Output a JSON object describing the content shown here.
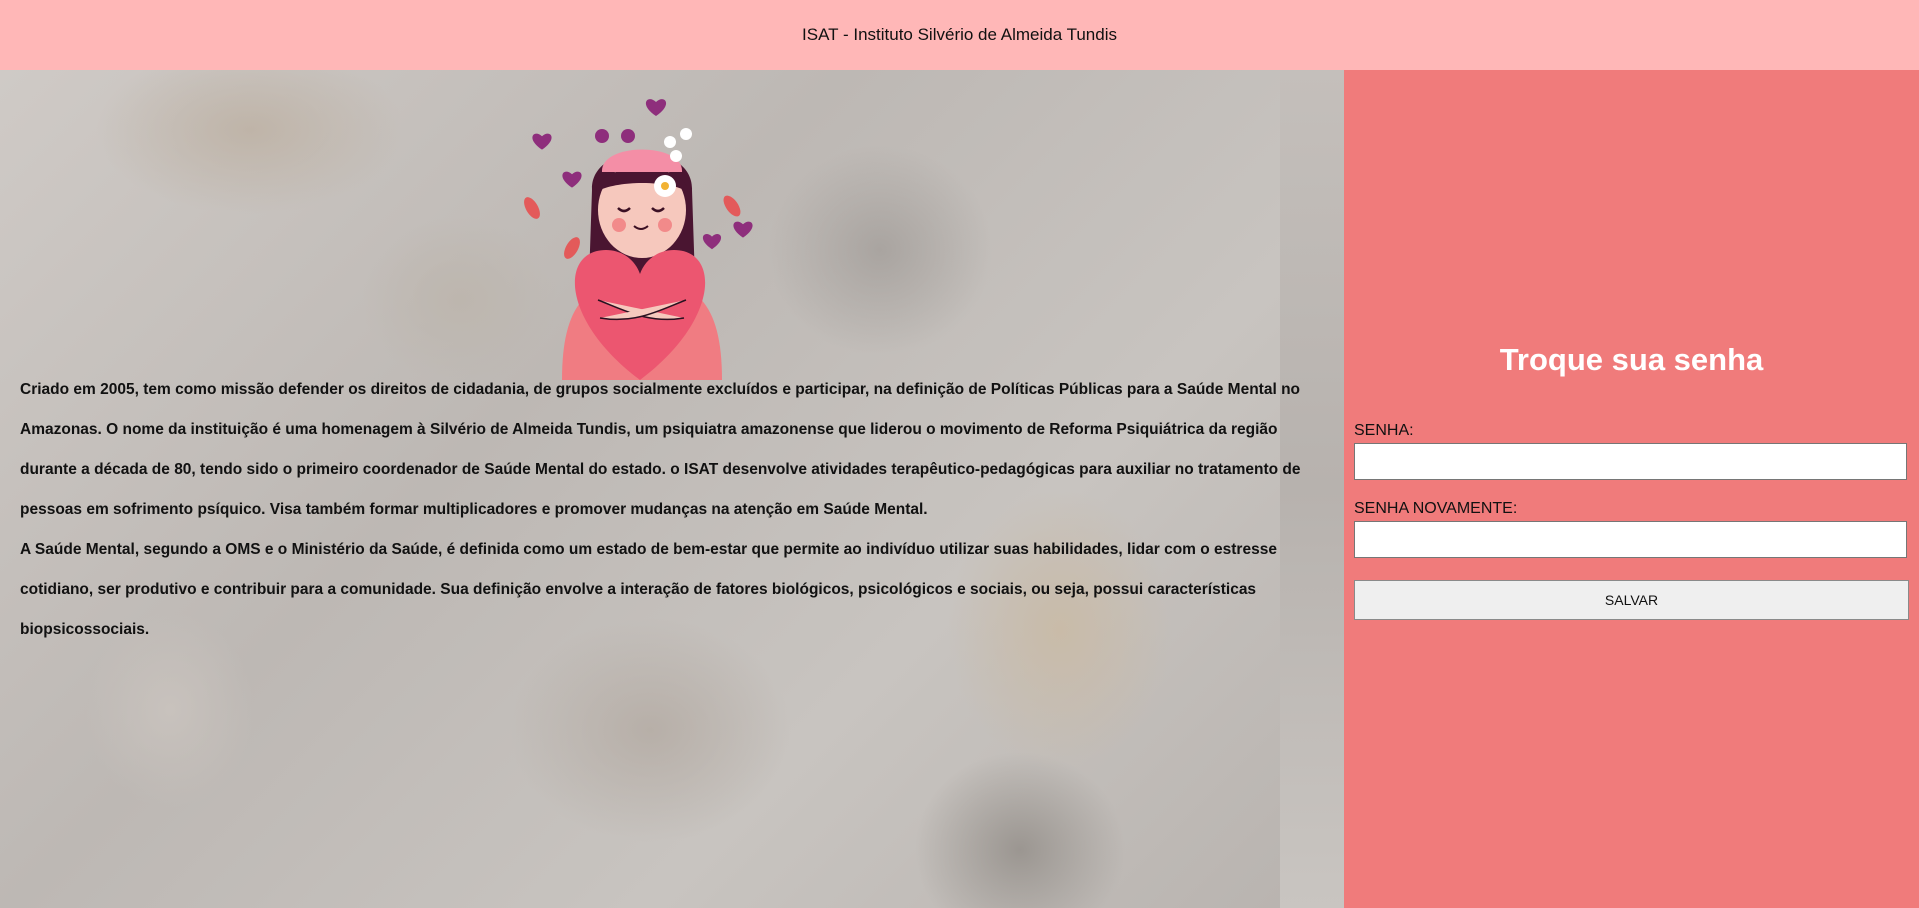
{
  "header": {
    "title": "ISAT - Instituto Silvério de Almeida Tundis"
  },
  "main": {
    "paragraphs": [
      "Criado em 2005, tem como missão defender os direitos de cidadania, de grupos socialmente excluídos e participar, na definição de Políticas Públicas para a Saúde Mental no Amazonas. O nome da instituição é uma homenagem à Silvério de Almeida Tundis, um psiquiatra amazonense que liderou o movimento de Reforma Psiquiátrica da região durante a década de 80, tendo sido o primeiro coordenador de Saúde Mental do estado. o ISAT desenvolve atividades terapêutico-pedagógicas para auxiliar no tratamento de pessoas em sofrimento psíquico. Visa também formar multiplicadores e promover mudanças na atenção em Saúde Mental.",
      "A Saúde Mental, segundo a OMS e o Ministério da Saúde, é definida como um estado de bem-estar que permite ao indivíduo utilizar suas habilidades, lidar com o estresse cotidiano, ser produtivo e contribuir para a comunidade. Sua definição envolve a interação de fatores biológicos, psicológicos e sociais, ou seja, possui características biopsicossociais."
    ]
  },
  "form": {
    "title": "Troque sua senha",
    "password_label": "SENHA:",
    "password_value": "",
    "password_again_label": "SENHA NOVAMENTE:",
    "password_again_value": "",
    "save_label": "SALVAR"
  },
  "colors": {
    "header_bg": "#ffb7b7",
    "form_bg": "#f07b7b",
    "overlay": "#d9d9d9"
  }
}
